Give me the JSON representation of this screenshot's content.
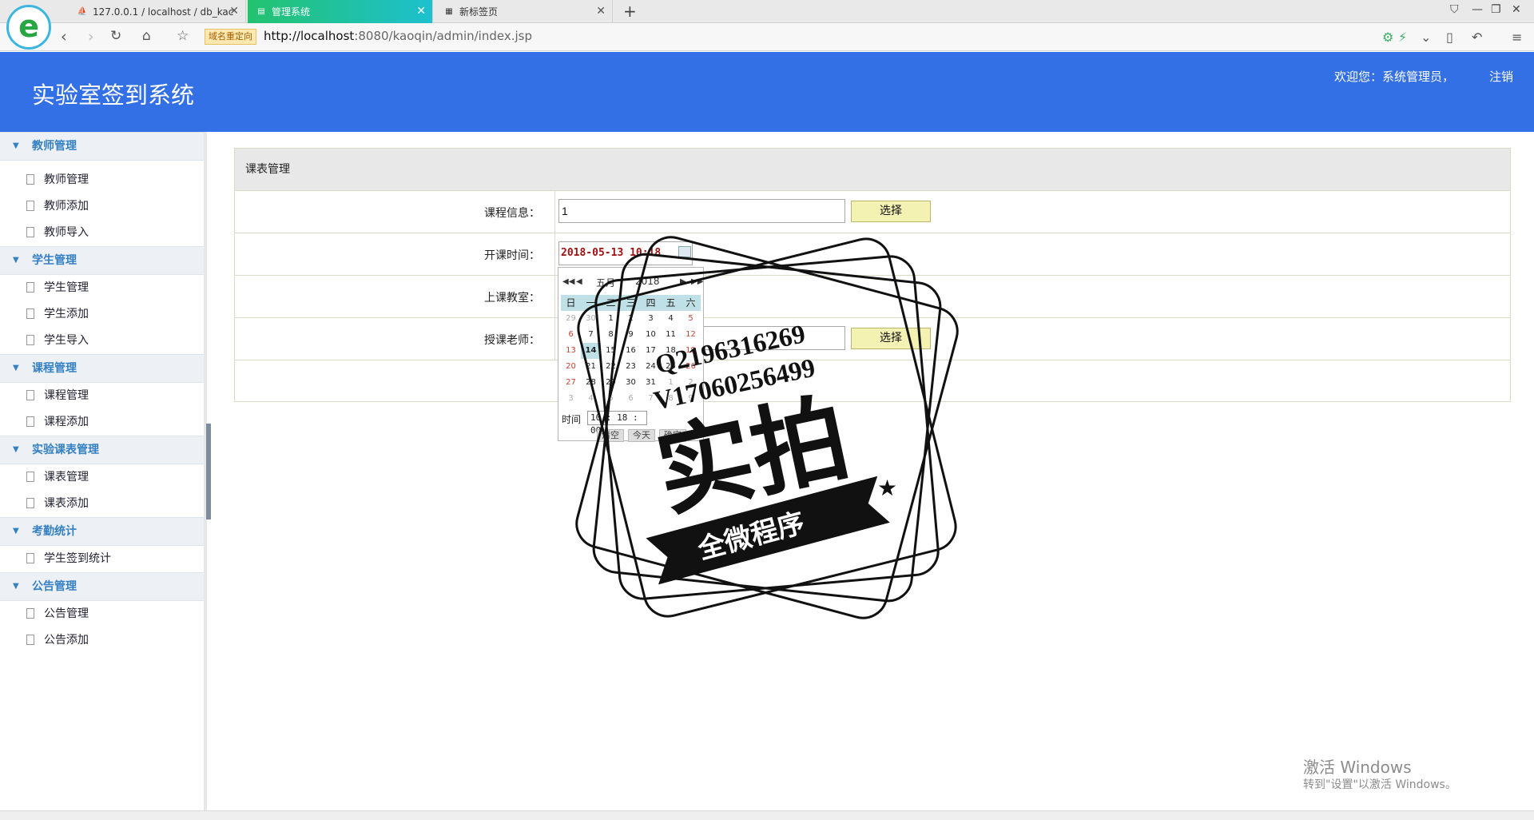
{
  "browser": {
    "tabs": [
      {
        "label": "127.0.0.1 / localhost / db_kac",
        "icon": "pma-icon"
      },
      {
        "label": "管理系统",
        "icon": "page-icon"
      },
      {
        "label": "新标签页",
        "icon": "grid-icon"
      }
    ],
    "redirect_tag": "域名重定向",
    "url_host": "http://localhost",
    "url_path": ":8080/kaoqin/admin/index.jsp"
  },
  "header": {
    "title": "实验室签到系统",
    "welcome": "欢迎您：系统管理员，",
    "logout": "注销",
    "color": "#3370e6"
  },
  "sidebar": {
    "groups": [
      {
        "title": "教师管理",
        "items": [
          "教师管理",
          "教师添加",
          "教师导入"
        ]
      },
      {
        "title": "学生管理",
        "items": [
          "学生管理",
          "学生添加",
          "学生导入"
        ]
      },
      {
        "title": "课程管理",
        "items": [
          "课程管理",
          "课程添加"
        ]
      },
      {
        "title": "实验课表管理",
        "items": [
          "课表管理",
          "课表添加"
        ]
      },
      {
        "title": "考勤统计",
        "items": [
          "学生签到统计"
        ]
      },
      {
        "title": "公告管理",
        "items": [
          "公告管理",
          "公告添加"
        ]
      }
    ]
  },
  "panel": {
    "title": "课表管理",
    "course_label": "课程信息：",
    "course_value": "1",
    "select_label": "选择",
    "start_time_label": "开课时间：",
    "start_time_value": "2018-05-13 10:18",
    "classroom_label": "上课教室：",
    "teacher_label": "授课老师：",
    "teacher_select_label": "选择"
  },
  "datepicker": {
    "month": "五月",
    "year": "2018",
    "weekdays": [
      "日",
      "一",
      "二",
      "三",
      "四",
      "五",
      "六"
    ],
    "weeks": [
      [
        "29",
        "30",
        "1",
        "2",
        "3",
        "4",
        "5"
      ],
      [
        "6",
        "7",
        "8",
        "9",
        "10",
        "11",
        "12"
      ],
      [
        "13",
        "14",
        "15",
        "16",
        "17",
        "18",
        "19"
      ],
      [
        "20",
        "21",
        "22",
        "23",
        "24",
        "25",
        "26"
      ],
      [
        "27",
        "28",
        "29",
        "30",
        "31",
        "1",
        "2"
      ],
      [
        "3",
        "4",
        "5",
        "6",
        "7",
        "8",
        "9"
      ]
    ],
    "selected_day": "14",
    "time_label": "时间",
    "time_value": "10 : 18 : 00",
    "clear_label": "清空",
    "today_label": "今天",
    "ok_label": "确定"
  },
  "watermark": {
    "line1": "Q2196316269",
    "line2": "V17060256499",
    "main": "实拍",
    "banner": "全微程序"
  },
  "windows": {
    "activate_title": "激活 Windows",
    "activate_sub": "转到\"设置\"以激活 Windows。"
  }
}
